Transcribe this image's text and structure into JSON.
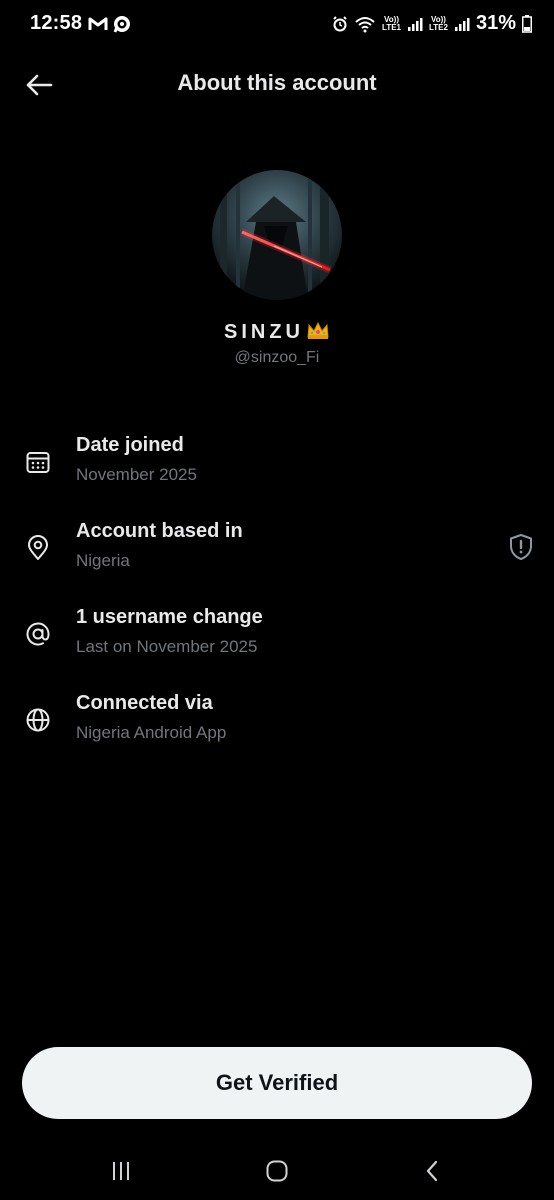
{
  "status_bar": {
    "time": "12:58",
    "left_icons": [
      "gmail-m-icon",
      "whatsapp-icon"
    ],
    "right_icons": [
      "alarm-icon",
      "wifi-icon",
      "signal-sim1-icon",
      "signal-sim2-icon",
      "battery-icon"
    ],
    "net1_top": "Vo))",
    "net1_bottom": "LTE1",
    "net2_top": "Vo))",
    "net2_bottom": "LTE2",
    "battery": "31%"
  },
  "header": {
    "title": "About this account",
    "back_icon": "arrow-left-icon"
  },
  "profile": {
    "display_name": "SINZU",
    "name_emoji": "crown",
    "handle": "@sinzoo_Fi"
  },
  "info_rows": [
    {
      "icon": "calendar-icon",
      "label": "Date joined",
      "value": "November 2025"
    },
    {
      "icon": "location-pin-icon",
      "label": "Account based in",
      "value": "Nigeria",
      "trailing_icon": "shield-icon"
    },
    {
      "icon": "at-sign-icon",
      "label": "1 username change",
      "value": "Last on November 2025"
    },
    {
      "icon": "globe-icon",
      "label": "Connected via",
      "value": "Nigeria Android App"
    }
  ],
  "cta": {
    "label": "Get Verified"
  },
  "nav": {
    "recents_icon": "recents-icon",
    "home_icon": "home-icon",
    "back_icon": "back-chevron-icon"
  },
  "colors": {
    "background": "#000000",
    "primary_text": "#e7e9ea",
    "secondary_text": "#71767b",
    "button_bg": "#eff3f4",
    "button_text": "#0f1419",
    "sword_glow": "#ff2a2a"
  }
}
